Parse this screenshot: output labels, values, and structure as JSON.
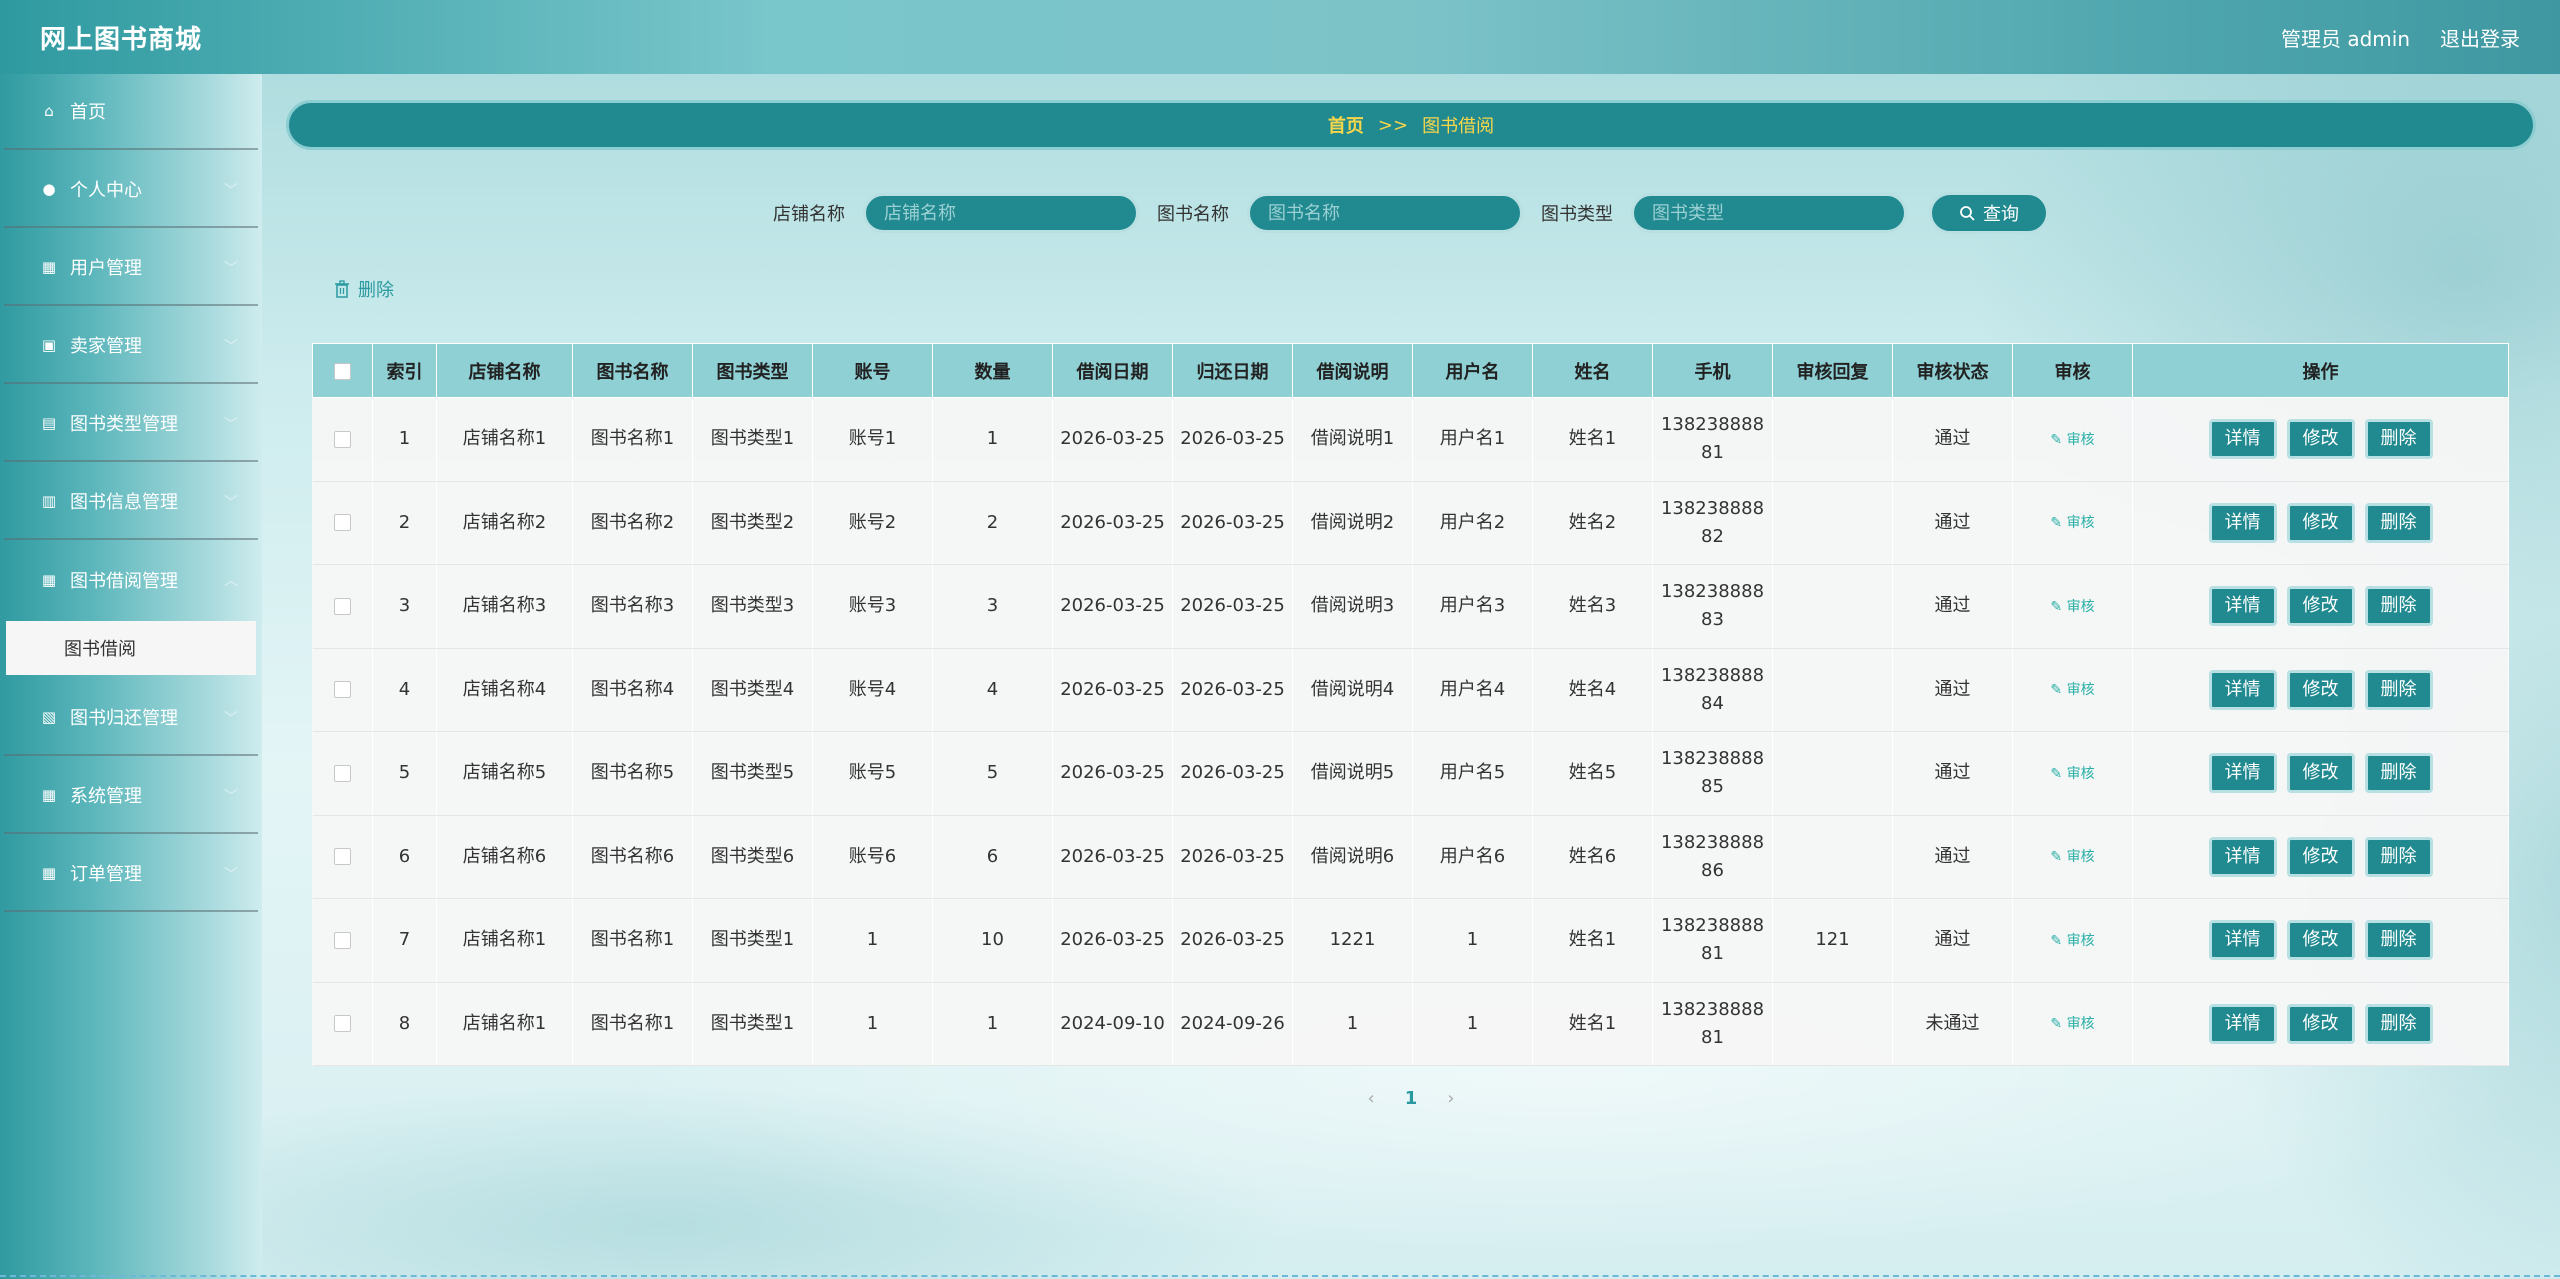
{
  "header": {
    "logo": "网上图书商城",
    "admin_label": "管理员 admin",
    "logout_label": "退出登录"
  },
  "sidebar": {
    "items": [
      {
        "label": "首页",
        "icon": "home-icon",
        "glyph": "⌂"
      },
      {
        "label": "个人中心",
        "icon": "user-icon",
        "glyph": "●"
      },
      {
        "label": "用户管理",
        "icon": "grid-icon",
        "glyph": "▦"
      },
      {
        "label": "卖家管理",
        "icon": "ticket-icon",
        "glyph": "▣"
      },
      {
        "label": "图书类型管理",
        "icon": "briefcase-icon",
        "glyph": "▤"
      },
      {
        "label": "图书信息管理",
        "icon": "printer-icon",
        "glyph": "▥"
      },
      {
        "label": "图书借阅管理",
        "icon": "grid-icon",
        "glyph": "▦"
      },
      {
        "label": "图书归还管理",
        "icon": "clipboard-icon",
        "glyph": "▧"
      },
      {
        "label": "系统管理",
        "icon": "grid-icon",
        "glyph": "▦"
      },
      {
        "label": "订单管理",
        "icon": "grid-icon",
        "glyph": "▦"
      }
    ],
    "active_sub": "图书借阅"
  },
  "breadcrumb": {
    "home": "首页",
    "sep": ">>",
    "current": "图书借阅"
  },
  "search": {
    "shop_label": "店铺名称",
    "shop_placeholder": "店铺名称",
    "book_label": "图书名称",
    "book_placeholder": "图书名称",
    "type_label": "图书类型",
    "type_placeholder": "图书类型",
    "query_label": "查询"
  },
  "delete_label": "删除",
  "table": {
    "columns": [
      "",
      "索引",
      "店铺名称",
      "图书名称",
      "图书类型",
      "账号",
      "数量",
      "借阅日期",
      "归还日期",
      "借阅说明",
      "用户名",
      "姓名",
      "手机",
      "审核回复",
      "审核状态",
      "审核",
      "操作"
    ],
    "review_label": "审核",
    "btn_detail": "详情",
    "btn_edit": "修改",
    "btn_delete": "删除",
    "rows": [
      {
        "idx": "1",
        "shop": "店铺名称1",
        "book": "图书名称1",
        "type": "图书类型1",
        "account": "账号1",
        "qty": "1",
        "borrow": "2026-03-25",
        "return": "2026-03-25",
        "note": "借阅说明1",
        "username": "用户名1",
        "name": "姓名1",
        "phone": "13823888881",
        "reply": "",
        "status": "通过"
      },
      {
        "idx": "2",
        "shop": "店铺名称2",
        "book": "图书名称2",
        "type": "图书类型2",
        "account": "账号2",
        "qty": "2",
        "borrow": "2026-03-25",
        "return": "2026-03-25",
        "note": "借阅说明2",
        "username": "用户名2",
        "name": "姓名2",
        "phone": "13823888882",
        "reply": "",
        "status": "通过"
      },
      {
        "idx": "3",
        "shop": "店铺名称3",
        "book": "图书名称3",
        "type": "图书类型3",
        "account": "账号3",
        "qty": "3",
        "borrow": "2026-03-25",
        "return": "2026-03-25",
        "note": "借阅说明3",
        "username": "用户名3",
        "name": "姓名3",
        "phone": "13823888883",
        "reply": "",
        "status": "通过"
      },
      {
        "idx": "4",
        "shop": "店铺名称4",
        "book": "图书名称4",
        "type": "图书类型4",
        "account": "账号4",
        "qty": "4",
        "borrow": "2026-03-25",
        "return": "2026-03-25",
        "note": "借阅说明4",
        "username": "用户名4",
        "name": "姓名4",
        "phone": "13823888884",
        "reply": "",
        "status": "通过"
      },
      {
        "idx": "5",
        "shop": "店铺名称5",
        "book": "图书名称5",
        "type": "图书类型5",
        "account": "账号5",
        "qty": "5",
        "borrow": "2026-03-25",
        "return": "2026-03-25",
        "note": "借阅说明5",
        "username": "用户名5",
        "name": "姓名5",
        "phone": "13823888885",
        "reply": "",
        "status": "通过"
      },
      {
        "idx": "6",
        "shop": "店铺名称6",
        "book": "图书名称6",
        "type": "图书类型6",
        "account": "账号6",
        "qty": "6",
        "borrow": "2026-03-25",
        "return": "2026-03-25",
        "note": "借阅说明6",
        "username": "用户名6",
        "name": "姓名6",
        "phone": "13823888886",
        "reply": "",
        "status": "通过"
      },
      {
        "idx": "7",
        "shop": "店铺名称1",
        "book": "图书名称1",
        "type": "图书类型1",
        "account": "1",
        "qty": "10",
        "borrow": "2026-03-25",
        "return": "2026-03-25",
        "note": "1221",
        "username": "1",
        "name": "姓名1",
        "phone": "13823888881",
        "reply": "121",
        "status": "通过"
      },
      {
        "idx": "8",
        "shop": "店铺名称1",
        "book": "图书名称1",
        "type": "图书类型1",
        "account": "1",
        "qty": "1",
        "borrow": "2024-09-10",
        "return": "2024-09-26",
        "note": "1",
        "username": "1",
        "name": "姓名1",
        "phone": "13823888881",
        "reply": "",
        "status": "未通过"
      }
    ]
  },
  "pager": {
    "prev": "‹",
    "page": "1",
    "next": "›"
  }
}
